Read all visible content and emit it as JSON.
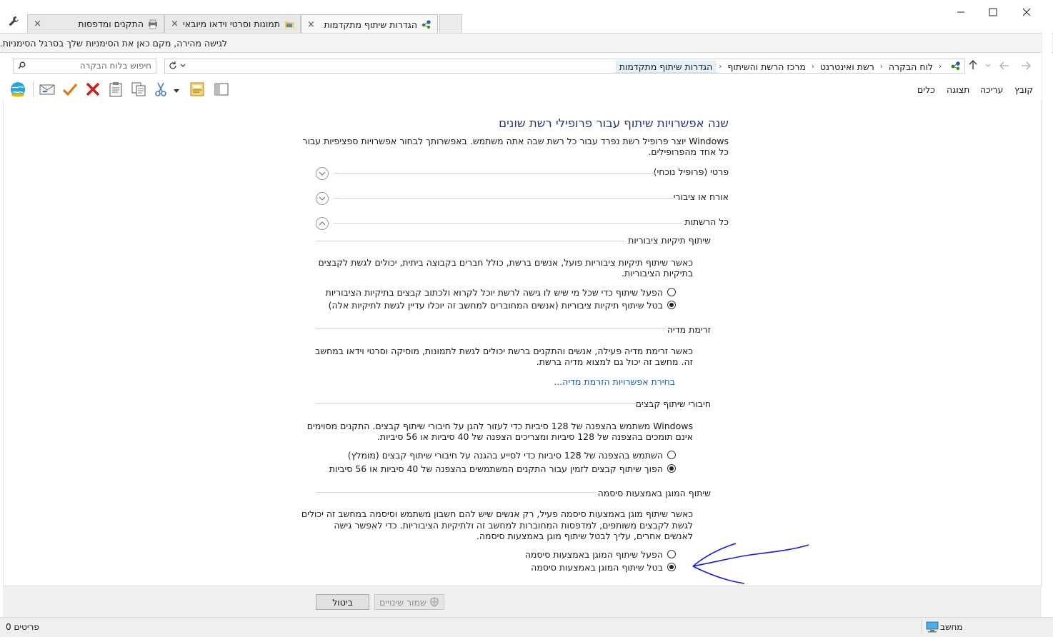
{
  "tabs": [
    {
      "label": "הגדרות שיתוף מתקדמות",
      "close": "×",
      "icon": "network-icon",
      "active": true
    },
    {
      "label": "תמונות וסרטי וידאו מיובאים",
      "close": "×",
      "icon": "folder-icon",
      "active": false
    },
    {
      "label": "התקנים ומדפסות",
      "close": "×",
      "icon": "printer-icon",
      "active": false
    }
  ],
  "bookmarks_hint": "לגישה מהירה, מקם כאן את הסימניות שלך בסרגל הסימניות.",
  "search": {
    "placeholder": "חיפוש בלוח הבקרה"
  },
  "breadcrumb": [
    "לוח הבקרה",
    "רשת ואינטרנט",
    "מרכז הרשת והשיתוף",
    "הגדרות שיתוף מתקדמות"
  ],
  "menu": [
    "קובץ",
    "עריכה",
    "תצוגה",
    "כלים"
  ],
  "title": "שנה אפשרויות שיתוף עבור פרופילי רשת שונים",
  "intro": [
    "Windows יוצר פרופיל רשת נפרד עבור כל רשת שבה אתה משתמש. באפשרותך לבחור אפשרויות ספציפיות עבור",
    "כל אחד מהפרופילים."
  ],
  "profiles": [
    "פרטי (פרופיל נוכחי)",
    "אורח או ציבורי",
    "כל הרשתות"
  ],
  "public_folders": {
    "heading": "שיתוף תיקיות ציבוריות",
    "desc": [
      "כאשר שיתוף תיקיות ציבוריות פועל, אנשים ברשת, כולל חברים בקבוצה ביתית, יכולים לגשת לקבצים",
      "בתיקיות הציבוריות."
    ],
    "options": [
      "הפעל שיתוף כדי שכל מי שיש לו גישה לרשת יוכל לקרוא ולכתוב קבצים בתיקיות הציבוריות",
      "בטל שיתוף תיקיות ציבוריות (אנשים המחוברים למחשב זה יוכלו עדיין לגשת לתיקיות אלה)"
    ],
    "selected": 1
  },
  "media": {
    "heading": "זרימת מדיה",
    "desc": [
      "כאשר זרימת מדיה פעילה, אנשים והתקנים ברשת יכולים לגשת לתמונות, מוסיקה וסרטי וידאו במחשב",
      "זה. מחשב זה יכול גם למצוא מדיה ברשת."
    ],
    "link": "בחירת אפשרויות הזרמת מדיה..."
  },
  "file_conn": {
    "heading": "חיבורי שיתוף קבצים",
    "desc": [
      "Windows משתמש בהצפנה של 128 סיביות כדי לעזור להגן על חיבורי שיתוף קבצים. התקנים מסוימים",
      "אינם תומכים בהצפנה של 128 סיביות ומצריכים הצפנה של 40 סיביות או 56 סיביות."
    ],
    "options": [
      "השתמש בהצפנה של 128 סיביות כדי לסייע בהגנה על חיבורי שיתוף קבצים (מומלץ)",
      "הפוך שיתוף קבצים לזמין עבור התקנים המשתמשים בהצפנה של 40 סיביות או 56 סיביות"
    ],
    "selected": 1
  },
  "password": {
    "heading": "שיתוף המוגן באמצעות סיסמה",
    "desc": [
      "כאשר שיתוף מוגן באמצעות סיסמה פעיל, רק אנשים שיש להם חשבון משתמש וסיסמה במחשב זה יכולים",
      "לגשת לקבצים משותפים, למדפסות המחוברות למחשב זה ולתיקיות הציבוריות. כדי לאפשר גישה",
      "לאנשים אחרים, עליך לבטל שיתוף מוגן באמצעות סיסמה."
    ],
    "options": [
      "הפעל שיתוף המוגן באמצעות סיסמה",
      "בטל שיתוף המוגן באמצעות סיסמה"
    ],
    "selected": 1
  },
  "buttons": {
    "save": "שמור שינויים",
    "cancel": "ביטול"
  },
  "status": {
    "items": "0 פריטים",
    "computer": "מחשב"
  },
  "colors": {
    "title": "#1e3287",
    "link": "#1a5fb4",
    "annotation": "#1a1adc"
  }
}
